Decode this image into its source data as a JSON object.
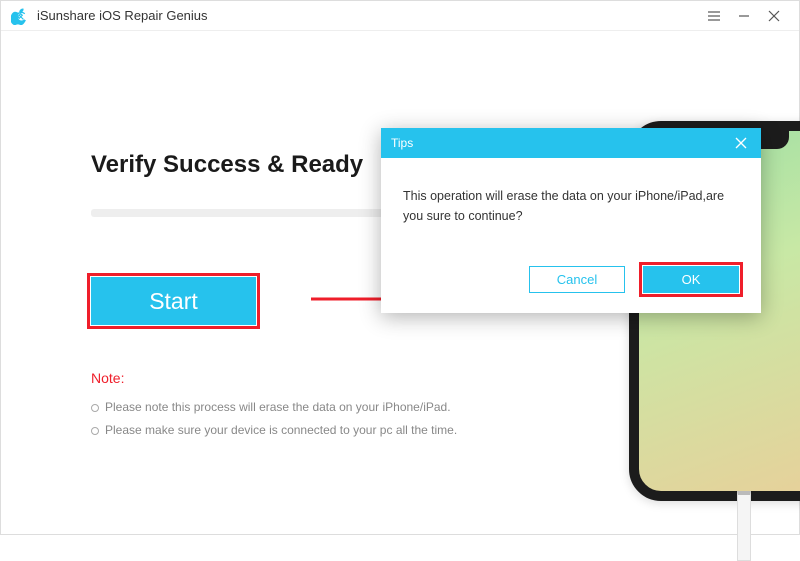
{
  "window": {
    "title": "iSunshare iOS Repair Genius"
  },
  "main": {
    "heading": "Verify Success & Ready",
    "start_label": "Start",
    "note_title": "Note:",
    "note_lines": [
      "Please note this process will erase the data on your iPhone/iPad.",
      "Please make sure your device is connected to your pc all the time."
    ]
  },
  "dialog": {
    "title": "Tips",
    "message": "This operation will erase the data on your iPhone/iPad,are you sure to continue?",
    "cancel_label": "Cancel",
    "ok_label": "OK"
  }
}
